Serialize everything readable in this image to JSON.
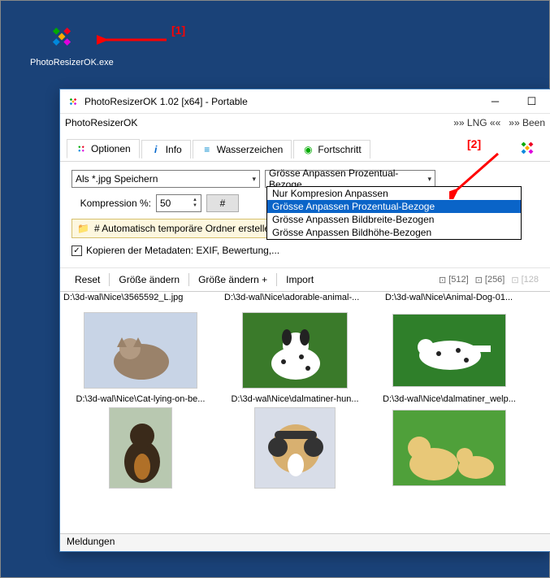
{
  "desktop": {
    "icon_label": "PhotoResizerOK.exe"
  },
  "annot": {
    "one": "[1]",
    "two": "[2]"
  },
  "window": {
    "title": "PhotoResizerOK 1.02 [x64] - Portable",
    "menubar": {
      "app": "PhotoResizerOK",
      "lng": "»» LNG ««",
      "beenden": "»» Been"
    },
    "tabs": {
      "options": "Optionen",
      "info": "Info",
      "watermark": "Wasserzeichen",
      "progress": "Fortschritt"
    },
    "options": {
      "save_as": "Als *.jpg Speichern",
      "resize_mode": "Grösse Anpassen Prozentual-Bezoge",
      "resize_choices": [
        "Nur Kompresion Anpassen",
        "Grösse Anpassen Prozentual-Bezoge",
        "Grösse Anpassen Bildbreite-Bezogen",
        "Grösse Anpassen Bildhöhe-Bezogen"
      ],
      "compression_label": "Kompression %:",
      "compression_value": "50",
      "hash": "#",
      "tempfolder": "# Automatisch temporäre Ordner erstellen",
      "copy_meta": "Kopieren der Metadaten: EXIF, Bewertung,..."
    },
    "toolbar": {
      "reset": "Reset",
      "resize": "Größe ändern",
      "resize_plus": "Größe ändern +",
      "import": "Import",
      "s512": "[512]",
      "s256": "[256]",
      "s128": "[128"
    },
    "paths": [
      "D:\\3d-wal\\Nice\\3565592_L.jpg",
      "D:\\3d-wal\\Nice\\adorable-animal-...",
      "D:\\3d-wal\\Nice\\Animal-Dog-01..."
    ],
    "thumbs": [
      {
        "cap": "D:\\3d-wal\\Nice\\Cat-lying-on-be..."
      },
      {
        "cap": "D:\\3d-wal\\Nice\\dalmatiner-hun..."
      },
      {
        "cap": "D:\\3d-wal\\Nice\\dalmatiner_welp..."
      },
      {
        "cap": ""
      },
      {
        "cap": ""
      },
      {
        "cap": ""
      }
    ],
    "status": "Meldungen"
  }
}
